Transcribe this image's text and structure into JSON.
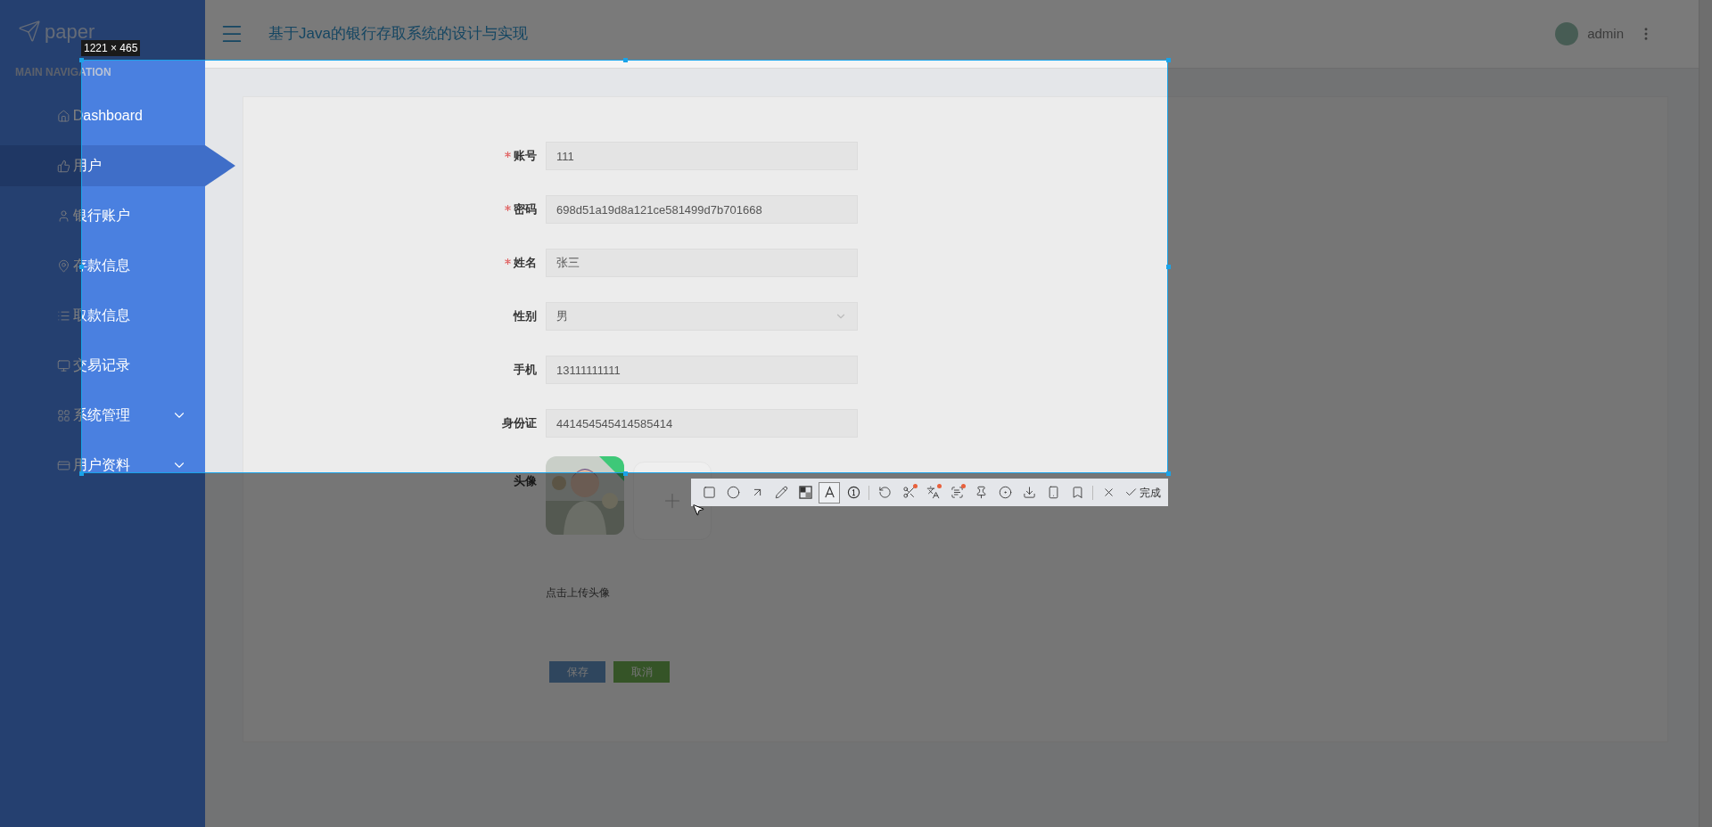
{
  "sidebar": {
    "brand": "paper",
    "section": "MAIN NAVIGATION",
    "items": [
      {
        "kind": "home",
        "label": "Dashboard",
        "selected": false,
        "expandable": false
      },
      {
        "kind": "thumb",
        "label": "用户",
        "selected": true,
        "expandable": false
      },
      {
        "kind": "user",
        "label": "银行账户",
        "selected": false,
        "expandable": false
      },
      {
        "kind": "pin",
        "label": "存款信息",
        "selected": false,
        "expandable": false
      },
      {
        "kind": "list",
        "label": "取款信息",
        "selected": false,
        "expandable": false
      },
      {
        "kind": "monitor",
        "label": "交易记录",
        "selected": false,
        "expandable": false
      },
      {
        "kind": "grid",
        "label": "系统管理",
        "selected": false,
        "expandable": true
      },
      {
        "kind": "card",
        "label": "用户资料",
        "selected": false,
        "expandable": true
      }
    ]
  },
  "header": {
    "title": "基于Java的银行存取系统的设计与实现",
    "user": "admin"
  },
  "form": {
    "fields": [
      {
        "kind": "text",
        "label": "账号",
        "required": true,
        "value": "111"
      },
      {
        "kind": "text",
        "label": "密码",
        "required": true,
        "value": "698d51a19d8a121ce581499d7b701668"
      },
      {
        "kind": "text",
        "label": "姓名",
        "required": true,
        "value": "张三"
      },
      {
        "kind": "select",
        "label": "性别",
        "required": false,
        "value": "男"
      },
      {
        "kind": "text",
        "label": "手机",
        "required": false,
        "value": "13111111111"
      },
      {
        "kind": "text",
        "label": "身份证",
        "required": false,
        "value": "441454545414585414"
      }
    ],
    "avatar": {
      "label": "头像",
      "hint": "点击上传头像"
    },
    "buttons": [
      {
        "kind": "primary",
        "label": "保存"
      },
      {
        "kind": "success",
        "label": "取消"
      }
    ]
  },
  "capture": {
    "size_label": "1221 × 465",
    "done": "完成",
    "tools": [
      {
        "kind": "rectangle",
        "selected": false,
        "badge": false
      },
      {
        "kind": "ellipse",
        "selected": false,
        "badge": false
      },
      {
        "kind": "arrow",
        "selected": false,
        "badge": false
      },
      {
        "kind": "pencil",
        "selected": false,
        "badge": false
      },
      {
        "kind": "mosaic",
        "selected": false,
        "badge": false
      },
      {
        "kind": "text",
        "selected": true,
        "badge": false
      },
      {
        "kind": "counter",
        "selected": false,
        "badge": false
      },
      {
        "kind": "sep"
      },
      {
        "kind": "undo",
        "selected": false,
        "badge": false
      },
      {
        "kind": "scissors",
        "selected": false,
        "badge": true
      },
      {
        "kind": "translate",
        "selected": false,
        "badge": true
      },
      {
        "kind": "ocr",
        "selected": false,
        "badge": true
      },
      {
        "kind": "pin",
        "selected": false,
        "badge": false
      },
      {
        "kind": "record",
        "selected": false,
        "badge": false
      },
      {
        "kind": "download",
        "selected": false,
        "badge": false
      },
      {
        "kind": "phone",
        "selected": false,
        "badge": false
      },
      {
        "kind": "bookmark",
        "selected": false,
        "badge": false
      },
      {
        "kind": "sep"
      },
      {
        "kind": "close",
        "selected": false,
        "badge": false
      }
    ]
  }
}
